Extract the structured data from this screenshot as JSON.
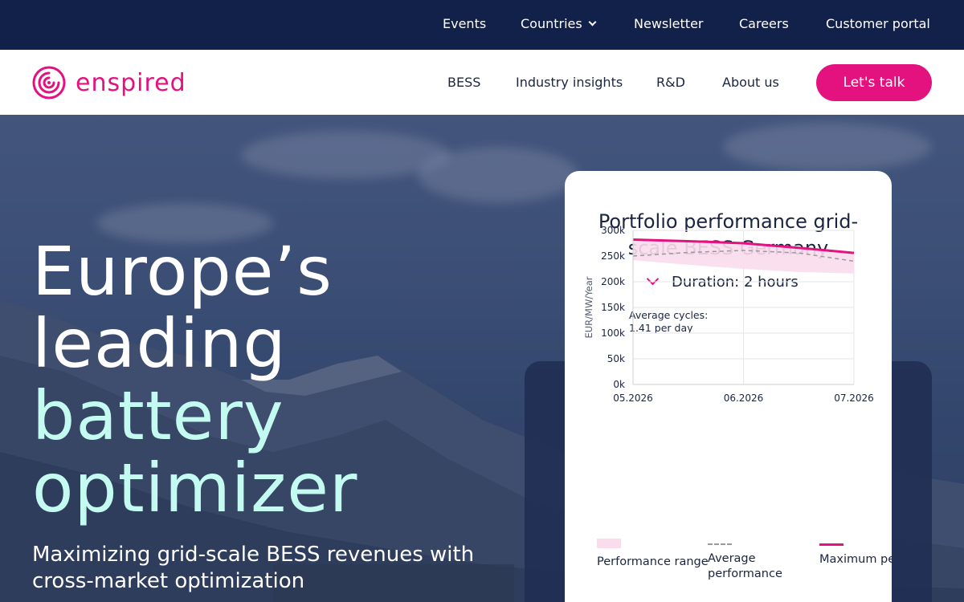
{
  "topbar": {
    "items": [
      "Events",
      "Countries",
      "Newsletter",
      "Careers",
      "Customer portal"
    ]
  },
  "nav": {
    "logo_text": "enspired",
    "links": [
      "BESS",
      "Industry insights",
      "R&D",
      "About us"
    ],
    "cta": "Let's talk"
  },
  "hero": {
    "headline_line1": "Europe’s",
    "headline_line2": "leading",
    "headline_line3": "battery",
    "headline_line4": "optimizer",
    "subhead": "Maximizing grid-scale BESS revenues with cross-market optimization"
  },
  "card": {
    "title": "Portfolio performance grid-scale BESS Germany",
    "duration": "Duration: 2 hours",
    "cycles_line1": "Average cycles:",
    "cycles_line2": "1.41 per day",
    "legend": {
      "range": "Performance range",
      "average": "Average performance",
      "maximum": "Maximum performance"
    }
  },
  "chart_data": {
    "type": "line",
    "title": "Portfolio performance grid-scale BESS Germany",
    "ylabel": "EUR/MW/Year",
    "xlabel": "",
    "x": [
      "05.2026",
      "06.2026",
      "07.2026"
    ],
    "x_ticks": [
      "05.2026",
      "06.2026",
      "07.2026"
    ],
    "y_ticks": [
      "300k",
      "250k",
      "200k",
      "150k",
      "100k",
      "50k",
      "0k"
    ],
    "ylim": [
      0,
      300000
    ],
    "grid": true,
    "legend_position": "bottom",
    "series": [
      {
        "name": "Maximum performance",
        "style": "solid",
        "color": "#e4127f",
        "x": [
          0,
          0.25,
          0.5,
          0.75,
          1
        ],
        "values": [
          282000,
          279000,
          275000,
          266000,
          256000
        ]
      },
      {
        "name": "Average performance",
        "style": "dashed",
        "color": "#999999",
        "x": [
          0,
          0.25,
          0.5,
          0.75,
          1
        ],
        "values": [
          250000,
          257000,
          261000,
          256000,
          240000
        ]
      },
      {
        "name": "Performance range",
        "style": "band",
        "color": "#fadcec",
        "x": [
          0,
          0.25,
          0.5,
          0.75,
          1
        ],
        "upper": [
          282000,
          279000,
          275000,
          266000,
          256000
        ],
        "lower": [
          242000,
          233000,
          225000,
          219000,
          216000
        ]
      }
    ]
  }
}
